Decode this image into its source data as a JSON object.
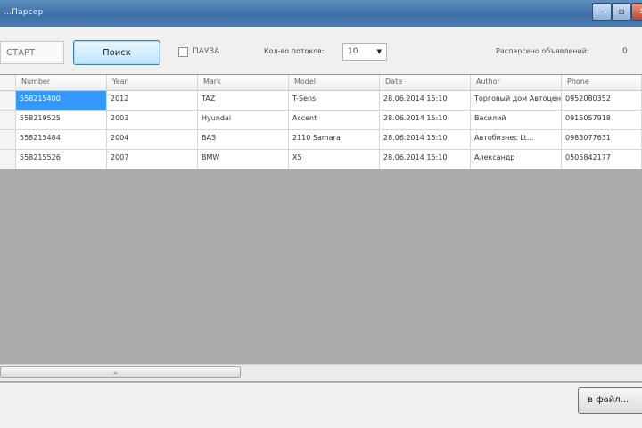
{
  "window": {
    "title": "...Парсер"
  },
  "toolbar": {
    "start_placeholder": "СТАРТ",
    "go_label": "Поиск",
    "checkbox_label": "ПАУЗА",
    "count_label": "Кол-во потоков:",
    "count_value": "10",
    "status_label": "Распарсено объявлений:",
    "status_value": "0"
  },
  "table": {
    "columns": [
      "Number",
      "Year",
      "Mark",
      "Model",
      "Date",
      "Author",
      "Phone"
    ],
    "rows": [
      [
        "558215400",
        "2012",
        "TAZ",
        "T-Sens",
        "28.06.2014 15:10",
        "Торговый дом Автоцентр...",
        "0952080352"
      ],
      [
        "558219525",
        "2003",
        "Hyundai",
        "Accent",
        "28.06.2014 15:10",
        "Василий",
        "0915057918"
      ],
      [
        "558215484",
        "2004",
        "ВАЗ",
        "2110 Samara",
        "28.06.2014 15:10",
        "Автобизнес Lt...",
        "0983077631"
      ],
      [
        "558215526",
        "2007",
        "BMW",
        "X5",
        "28.06.2014 15:10",
        "Александр",
        "0505842177"
      ]
    ],
    "selected_cell": "558215400"
  },
  "footer": {
    "button_label": "в файл..."
  }
}
